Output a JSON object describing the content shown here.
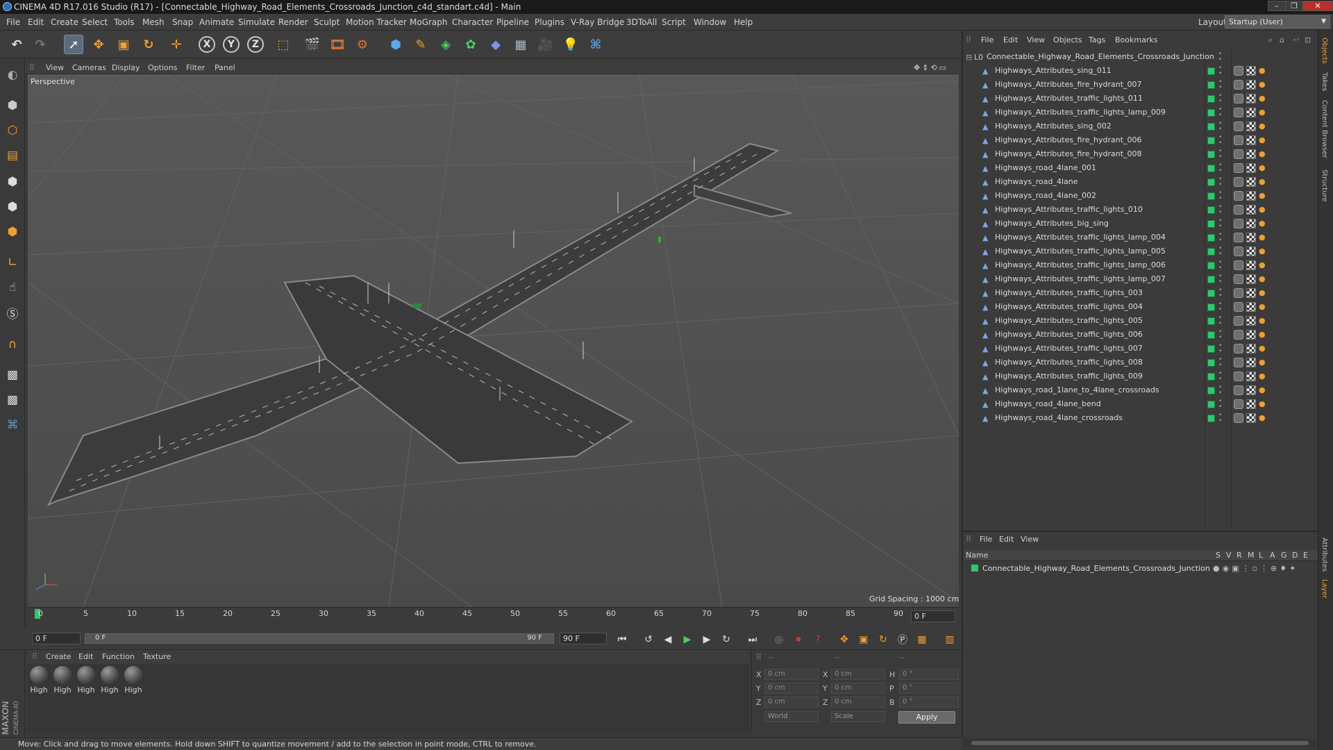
{
  "window": {
    "title": "CINEMA 4D R17.016 Studio (R17) - [Connectable_Highway_Road_Elements_Crossroads_Junction_c4d_standart.c4d] - Main",
    "controls": [
      "–",
      "❐",
      "✕"
    ]
  },
  "menubar": {
    "items": [
      "File",
      "Edit",
      "Create",
      "Select",
      "Tools",
      "Mesh",
      "Snap",
      "Animate",
      "Simulate",
      "Render",
      "Sculpt",
      "Motion Tracker",
      "MoGraph",
      "Character",
      "Pipeline",
      "Plugins",
      "V-Ray Bridge",
      "3DToAll",
      "Script",
      "Window",
      "Help"
    ],
    "layout_label": "Layout:",
    "layout_value": "Startup (User)"
  },
  "toolbar": {
    "axis_x": "X",
    "axis_y": "Y",
    "axis_z": "Z"
  },
  "viewport": {
    "menu": [
      "View",
      "Cameras",
      "Display",
      "Options",
      "Filter",
      "Panel"
    ],
    "label": "Perspective",
    "grid_spacing": "Grid Spacing : 1000 cm"
  },
  "timeline": {
    "ticks": [
      "0",
      "5",
      "10",
      "15",
      "20",
      "25",
      "30",
      "35",
      "40",
      "45",
      "50",
      "55",
      "60",
      "65",
      "70",
      "75",
      "80",
      "85",
      "90"
    ],
    "current_frame": "0 F",
    "start_frame": "0 F",
    "range_start": "0 F",
    "range_end": "90 F",
    "end_frame": "90 F"
  },
  "materials": {
    "menu": [
      "Create",
      "Edit",
      "Function",
      "Texture"
    ],
    "items": [
      "High",
      "High",
      "High",
      "High",
      "High"
    ]
  },
  "coordinates": {
    "header": [
      "--",
      "--",
      "--"
    ],
    "rows": [
      {
        "l1": "X",
        "v1": "0 cm",
        "l2": "X",
        "v2": "0 cm",
        "l3": "H",
        "v3": "0 °"
      },
      {
        "l1": "Y",
        "v1": "0 cm",
        "l2": "Y",
        "v2": "0 cm",
        "l3": "P",
        "v3": "0 °"
      },
      {
        "l1": "Z",
        "v1": "0 cm",
        "l2": "Z",
        "v2": "0 cm",
        "l3": "B",
        "v3": "0 °"
      }
    ],
    "mode1": "World",
    "mode2": "Scale",
    "apply": "Apply"
  },
  "status": {
    "text": "Move: Click and drag to move elements. Hold down SHIFT to quantize movement / add to the selection in point mode, CTRL to remove."
  },
  "object_manager": {
    "menu": [
      "File",
      "Edit",
      "View",
      "Objects",
      "Tags",
      "Bookmarks"
    ],
    "root": "Connectable_Highway_Road_Elements_Crossroads_Junction",
    "objects": [
      "Highways_Attributes_sing_011",
      "Highways_Attributes_fire_hydrant_007",
      "Highways_Attributes_traffic_lights_011",
      "Highways_Attributes_traffic_lights_lamp_009",
      "Highways_Attributes_sing_002",
      "Highways_Attributes_fire_hydrant_006",
      "Highways_Attributes_fire_hydrant_008",
      "Highways_road_4lane_001",
      "Highways_road_4lane",
      "Highways_road_4lane_002",
      "Highways_Attributes_traffic_lights_010",
      "Highways_Attributes_big_sing",
      "Highways_Attributes_traffic_lights_lamp_004",
      "Highways_Attributes_traffic_lights_lamp_005",
      "Highways_Attributes_traffic_lights_lamp_006",
      "Highways_Attributes_traffic_lights_lamp_007",
      "Highways_Attributes_traffic_lights_003",
      "Highways_Attributes_traffic_lights_004",
      "Highways_Attributes_traffic_lights_005",
      "Highways_Attributes_traffic_lights_006",
      "Highways_Attributes_traffic_lights_007",
      "Highways_Attributes_traffic_lights_008",
      "Highways_Attributes_traffic_lights_009",
      "Highways_road_1lane_to_4lane_crossroads",
      "Highways_road_4lane_bend",
      "Highways_road_4lane_crossroads"
    ]
  },
  "layer_manager": {
    "menu": [
      "File",
      "Edit",
      "View"
    ],
    "col_name": "Name",
    "cols": [
      "S",
      "V",
      "R",
      "M",
      "L",
      "A",
      "G",
      "D",
      "E"
    ],
    "layer": "Connectable_Highway_Road_Elements_Crossroads_Junction"
  },
  "right_tabs": [
    "Objects",
    "Takes",
    "Content Browser",
    "Structure",
    "Attributes",
    "Layer"
  ],
  "colors": {
    "accent_green": "#2fc86f",
    "selection": "#5b6b7d",
    "close_red": "#b8302a"
  }
}
